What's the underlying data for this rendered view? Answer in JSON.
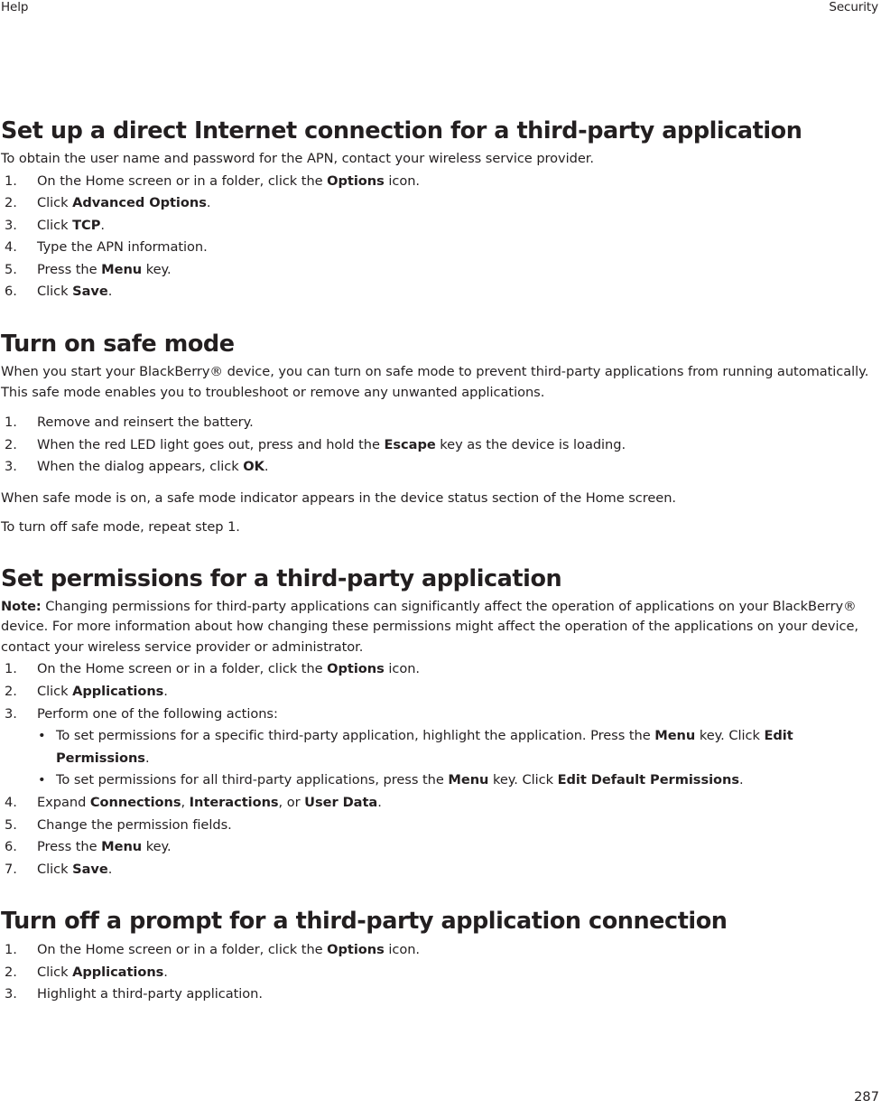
{
  "header": {
    "left": "Help",
    "right": "Security"
  },
  "footer": {
    "page_number": "287"
  },
  "sections": [
    {
      "title": "Set up a direct Internet connection for a third-party application",
      "intro": "To obtain the user name and password for the APN, contact your wireless service provider.",
      "steps": [
        {
          "num": "1.",
          "pre": "On the Home screen or in a folder, click the ",
          "bold": "Options",
          "post": " icon."
        },
        {
          "num": "2.",
          "pre": "Click ",
          "bold": "Advanced Options",
          "post": "."
        },
        {
          "num": "3.",
          "pre": "Click ",
          "bold": "TCP",
          "post": "."
        },
        {
          "num": "4.",
          "pre": "Type the APN information.",
          "bold": "",
          "post": ""
        },
        {
          "num": "5.",
          "pre": "Press the ",
          "bold": "Menu",
          "post": " key."
        },
        {
          "num": "6.",
          "pre": "Click ",
          "bold": "Save",
          "post": "."
        }
      ]
    },
    {
      "title": "Turn on safe mode",
      "intro": "When you start your BlackBerry® device, you can turn on safe mode to prevent third-party applications from running automatically. This safe mode enables you to troubleshoot or remove any unwanted applications.",
      "steps": [
        {
          "num": "1.",
          "pre": "Remove and reinsert the battery.",
          "bold": "",
          "post": ""
        },
        {
          "num": "2.",
          "pre": "When the red LED light goes out, press and hold the ",
          "bold": "Escape",
          "post": " key as the device is loading."
        },
        {
          "num": "3.",
          "pre": "When the dialog appears, click ",
          "bold": "OK",
          "post": "."
        }
      ],
      "outro": [
        "When safe mode is on, a safe mode indicator appears in the device status section of the Home screen.",
        "To turn off safe mode, repeat step 1."
      ]
    },
    {
      "title": "Set permissions for a third-party application",
      "note_label": "Note:",
      "note_text": "  Changing permissions for third-party applications can significantly affect the operation of applications on your BlackBerry® device. For more information about how changing these permissions might affect the operation of the applications on your device, contact your wireless service provider or administrator.",
      "steps": [
        {
          "num": "1.",
          "pre": "On the Home screen or in a folder, click the ",
          "bold": "Options",
          "post": " icon."
        },
        {
          "num": "2.",
          "pre": "Click ",
          "bold": "Applications",
          "post": "."
        },
        {
          "num": "3.",
          "pre": "Perform one of the following actions:",
          "bold": "",
          "post": ""
        }
      ],
      "substeps": [
        {
          "pre": "To set permissions for a specific third-party application, highlight the application. Press the ",
          "bold1": "Menu",
          "mid": " key. Click ",
          "bold2": "Edit Permissions",
          "post": "."
        },
        {
          "pre": "To set permissions for all third-party applications, press the ",
          "bold1": "Menu",
          "mid": " key. Click ",
          "bold2": "Edit Default Permissions",
          "post": "."
        }
      ],
      "steps_cont": [
        {
          "num": "4.",
          "pre": "Expand ",
          "bold": "Connections",
          "mid1": ", ",
          "bold2": "Interactions",
          "mid2": ", or ",
          "bold3": "User Data",
          "post": "."
        },
        {
          "num": "5.",
          "pre": "Change the permission fields.",
          "bold": "",
          "post": ""
        },
        {
          "num": "6.",
          "pre": "Press the ",
          "bold": "Menu",
          "post": " key."
        },
        {
          "num": "7.",
          "pre": "Click ",
          "bold": "Save",
          "post": "."
        }
      ]
    },
    {
      "title": "Turn off a prompt for a third-party application connection",
      "steps": [
        {
          "num": "1.",
          "pre": "On the Home screen or in a folder, click the ",
          "bold": "Options",
          "post": " icon."
        },
        {
          "num": "2.",
          "pre": "Click ",
          "bold": "Applications",
          "post": "."
        },
        {
          "num": "3.",
          "pre": "Highlight a third-party application.",
          "bold": "",
          "post": ""
        }
      ]
    }
  ],
  "icons": {
    "bullet": "•"
  }
}
